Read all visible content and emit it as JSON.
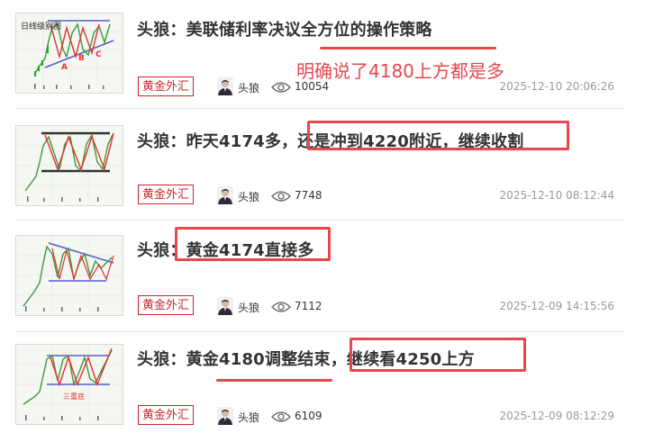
{
  "articles": [
    {
      "title": "头狼：美联储利率决议全方位的操作策略",
      "tag": "黄金外汇",
      "author": "头狼",
      "views": "10054",
      "date": "2025-12-10 20:06:26",
      "thumb_label": "日线级别图"
    },
    {
      "title": "头狼：昨天4174多，还是冲到4220附近，继续收割",
      "tag": "黄金外汇",
      "author": "头狼",
      "views": "7748",
      "date": "2025-12-10 08:12:44"
    },
    {
      "title": "头狼：黄金4174直接多",
      "tag": "黄金外汇",
      "author": "头狼",
      "views": "7112",
      "date": "2025-12-09 14:15:56"
    },
    {
      "title": "头狼：黄金4180调整结束，继续看4250上方",
      "tag": "黄金外汇",
      "author": "头狼",
      "views": "6109",
      "date": "2025-12-09 08:12:29",
      "thumb_label": "三重底"
    }
  ],
  "annotation": {
    "note": "明确说了4180上方都是多",
    "color": "#e8474c"
  },
  "icons": {
    "views": "eye-icon",
    "author": "avatar"
  }
}
